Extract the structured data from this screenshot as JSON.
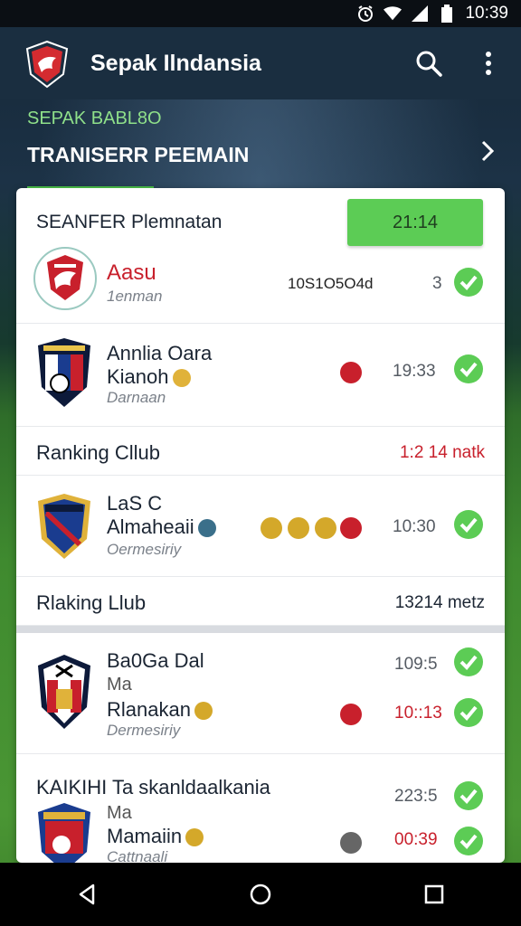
{
  "status_bar": {
    "time": "10:39",
    "icons": [
      "alarm-icon",
      "wifi-icon",
      "signal-icon",
      "battery-icon"
    ]
  },
  "app_bar": {
    "title": "Sepak Ilndansia",
    "actions": [
      "search-icon",
      "more-vert-icon"
    ]
  },
  "sub_header": {
    "label": "SEPAK BABL8O",
    "title": "TRANISERR PEEMAIN"
  },
  "card": {
    "title": "SEANFER Plemnatan",
    "time_button": "21:14"
  },
  "rows": [
    {
      "name": "Aasu",
      "sub": "1enman",
      "mid": "10S1O5O4d",
      "time": "3",
      "checked": true
    },
    {
      "name_line1": "Annlia Oara",
      "name_line2": "Kianoh",
      "sub": "Darnaan",
      "time": "19:33",
      "checked": true
    },
    {
      "name_line1": "LaS C",
      "name_line2": "Almaheaii",
      "sub": "Oermesiriy",
      "time": "10:30",
      "checked": true
    },
    {
      "name_line1": "Ba0Ga Dal",
      "name_line2": "Ma",
      "name_line3": "Rlanakan",
      "sub": "Dermesiriy",
      "time1": "109:5",
      "time2": "10::13",
      "checked": true
    },
    {
      "name_line1": "KAIKIHI Ta skanldaalkania",
      "name_line2": "Ma",
      "name_line3": "Mamaiin",
      "sub": "Cattnaali",
      "time1": "223:5",
      "time2": "00:39",
      "checked": true
    }
  ],
  "sections": [
    {
      "label": "Ranking Cllub",
      "right": "1:2 14 natk"
    },
    {
      "label": "Rlaking Llub",
      "right": "13214 metz"
    }
  ],
  "colors": {
    "accent": "#5ccc55",
    "appbar": "#1a2e40",
    "red": "#c8202c"
  }
}
